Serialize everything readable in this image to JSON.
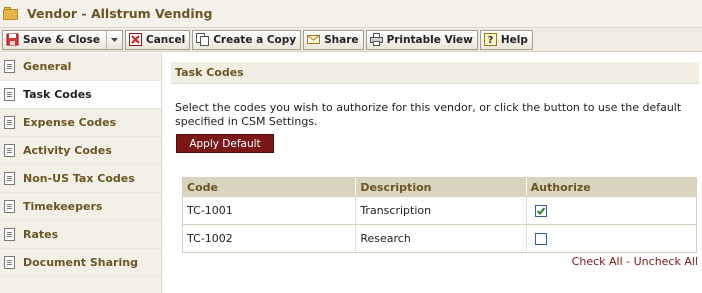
{
  "window": {
    "title": "Vendor - Allstrum Vending"
  },
  "toolbar": {
    "save_close": "Save & Close",
    "cancel": "Cancel",
    "create_copy": "Create a Copy",
    "share": "Share",
    "printable_view": "Printable View",
    "help": "Help"
  },
  "sidebar": {
    "items": [
      {
        "label": "General"
      },
      {
        "label": "Task Codes"
      },
      {
        "label": "Expense Codes"
      },
      {
        "label": "Activity Codes"
      },
      {
        "label": "Non-US Tax Codes"
      },
      {
        "label": "Timekeepers"
      },
      {
        "label": "Rates"
      },
      {
        "label": "Document Sharing"
      }
    ]
  },
  "main": {
    "section_title": "Task Codes",
    "description": "Select the codes you wish to authorize for this vendor, or click the button to use the default specified in CSM Settings.",
    "apply_default": "Apply Default",
    "table": {
      "headers": {
        "code": "Code",
        "description": "Description",
        "authorize": "Authorize"
      },
      "rows": [
        {
          "code": "TC-1001",
          "description": "Transcription",
          "authorized": true
        },
        {
          "code": "TC-1002",
          "description": "Research",
          "authorized": false
        }
      ]
    },
    "check_all": "Check All",
    "separator": " - ",
    "uncheck_all": "Uncheck All"
  }
}
